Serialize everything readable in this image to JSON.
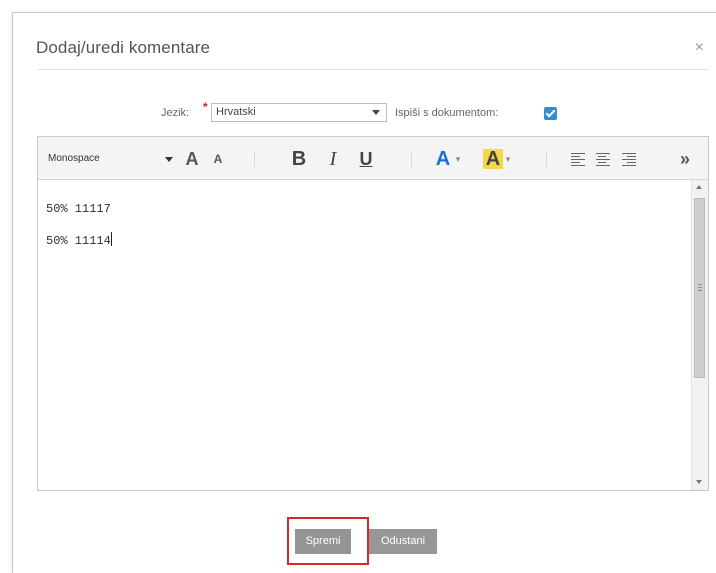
{
  "dialog": {
    "title": "Dodaj/uredi komentare",
    "close_glyph": "×"
  },
  "language": {
    "label": "Jezik:",
    "required_mark": "*",
    "selected": "Hrvatski",
    "print_label": "Ispiši s dokumentom:",
    "print_checked": true
  },
  "toolbar": {
    "font_family": "Monospace",
    "grow_font": "A",
    "shrink_font": "A",
    "bold": "B",
    "italic": "I",
    "underline": "U",
    "font_color": "A",
    "highlight": "A",
    "more": "»",
    "icons": [
      "grow-font-icon",
      "shrink-font-icon",
      "bold-icon",
      "italic-icon",
      "underline-icon",
      "font-color-icon",
      "highlight-icon",
      "align-left-icon",
      "align-center-icon",
      "align-right-icon",
      "more-icon"
    ]
  },
  "editor": {
    "lines": [
      "50% 11117",
      "50% 11114"
    ]
  },
  "buttons": {
    "save": "Spremi",
    "cancel": "Odustani"
  },
  "colors": {
    "checkbox": "#2e8fd6",
    "required": "#e0191b",
    "font_color": "#1a6fd4",
    "highlight": "#f5d84a",
    "save_focus_frame": "#d8262b",
    "button_bg": "#959595"
  }
}
